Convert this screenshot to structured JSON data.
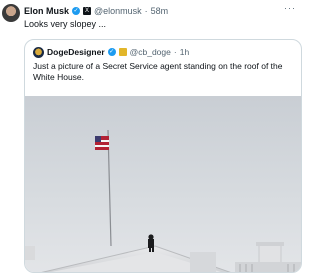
{
  "tweet": {
    "author_name": "Elon Musk",
    "handle": "@elonmusk",
    "time": "58m",
    "text": "Looks very slopey ...",
    "more": "···"
  },
  "quote": {
    "author_name": "DogeDesigner",
    "handle": "@cb_doge",
    "time": "1h",
    "text": "Just a picture of a Secret Service agent standing on the roof of the White House."
  },
  "colors": {
    "verified_blue": "#1d9bf0",
    "affiliate_gold": "#e2b62a",
    "muted_text": "#536471",
    "border": "#cfd9de"
  },
  "icons": {
    "verified": "verified-badge-icon",
    "x_affiliation": "x-logo-icon",
    "gold_affiliation": "gold-affiliation-icon",
    "more": "more-options-icon"
  }
}
